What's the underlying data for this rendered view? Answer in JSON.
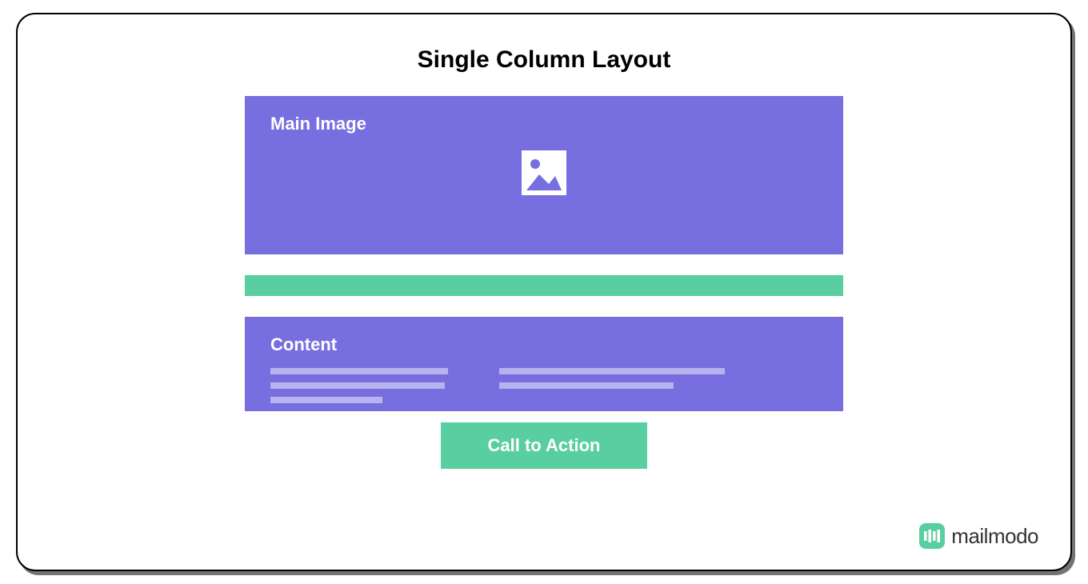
{
  "title": "Single Column Layout",
  "blocks": {
    "main_image_label": "Main Image",
    "content_label": "Content",
    "cta_label": "Call to Action"
  },
  "brand": {
    "name": "mailmodo"
  },
  "colors": {
    "purple": "#776fe0",
    "green": "#59cea0",
    "purple_light": "#b7b3ef"
  }
}
